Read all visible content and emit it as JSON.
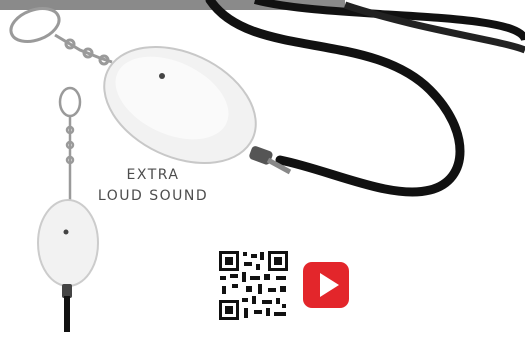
{
  "feature": {
    "line1": "EXTRA",
    "line2": "LOUD SOUND"
  },
  "icons": {
    "qr": "qr-code-icon",
    "video": "youtube-play-icon"
  },
  "colors": {
    "play_red": "#e3262b",
    "lanyard": "#111111",
    "device_body": "#f2f2f2",
    "text": "#4d4d4d"
  }
}
